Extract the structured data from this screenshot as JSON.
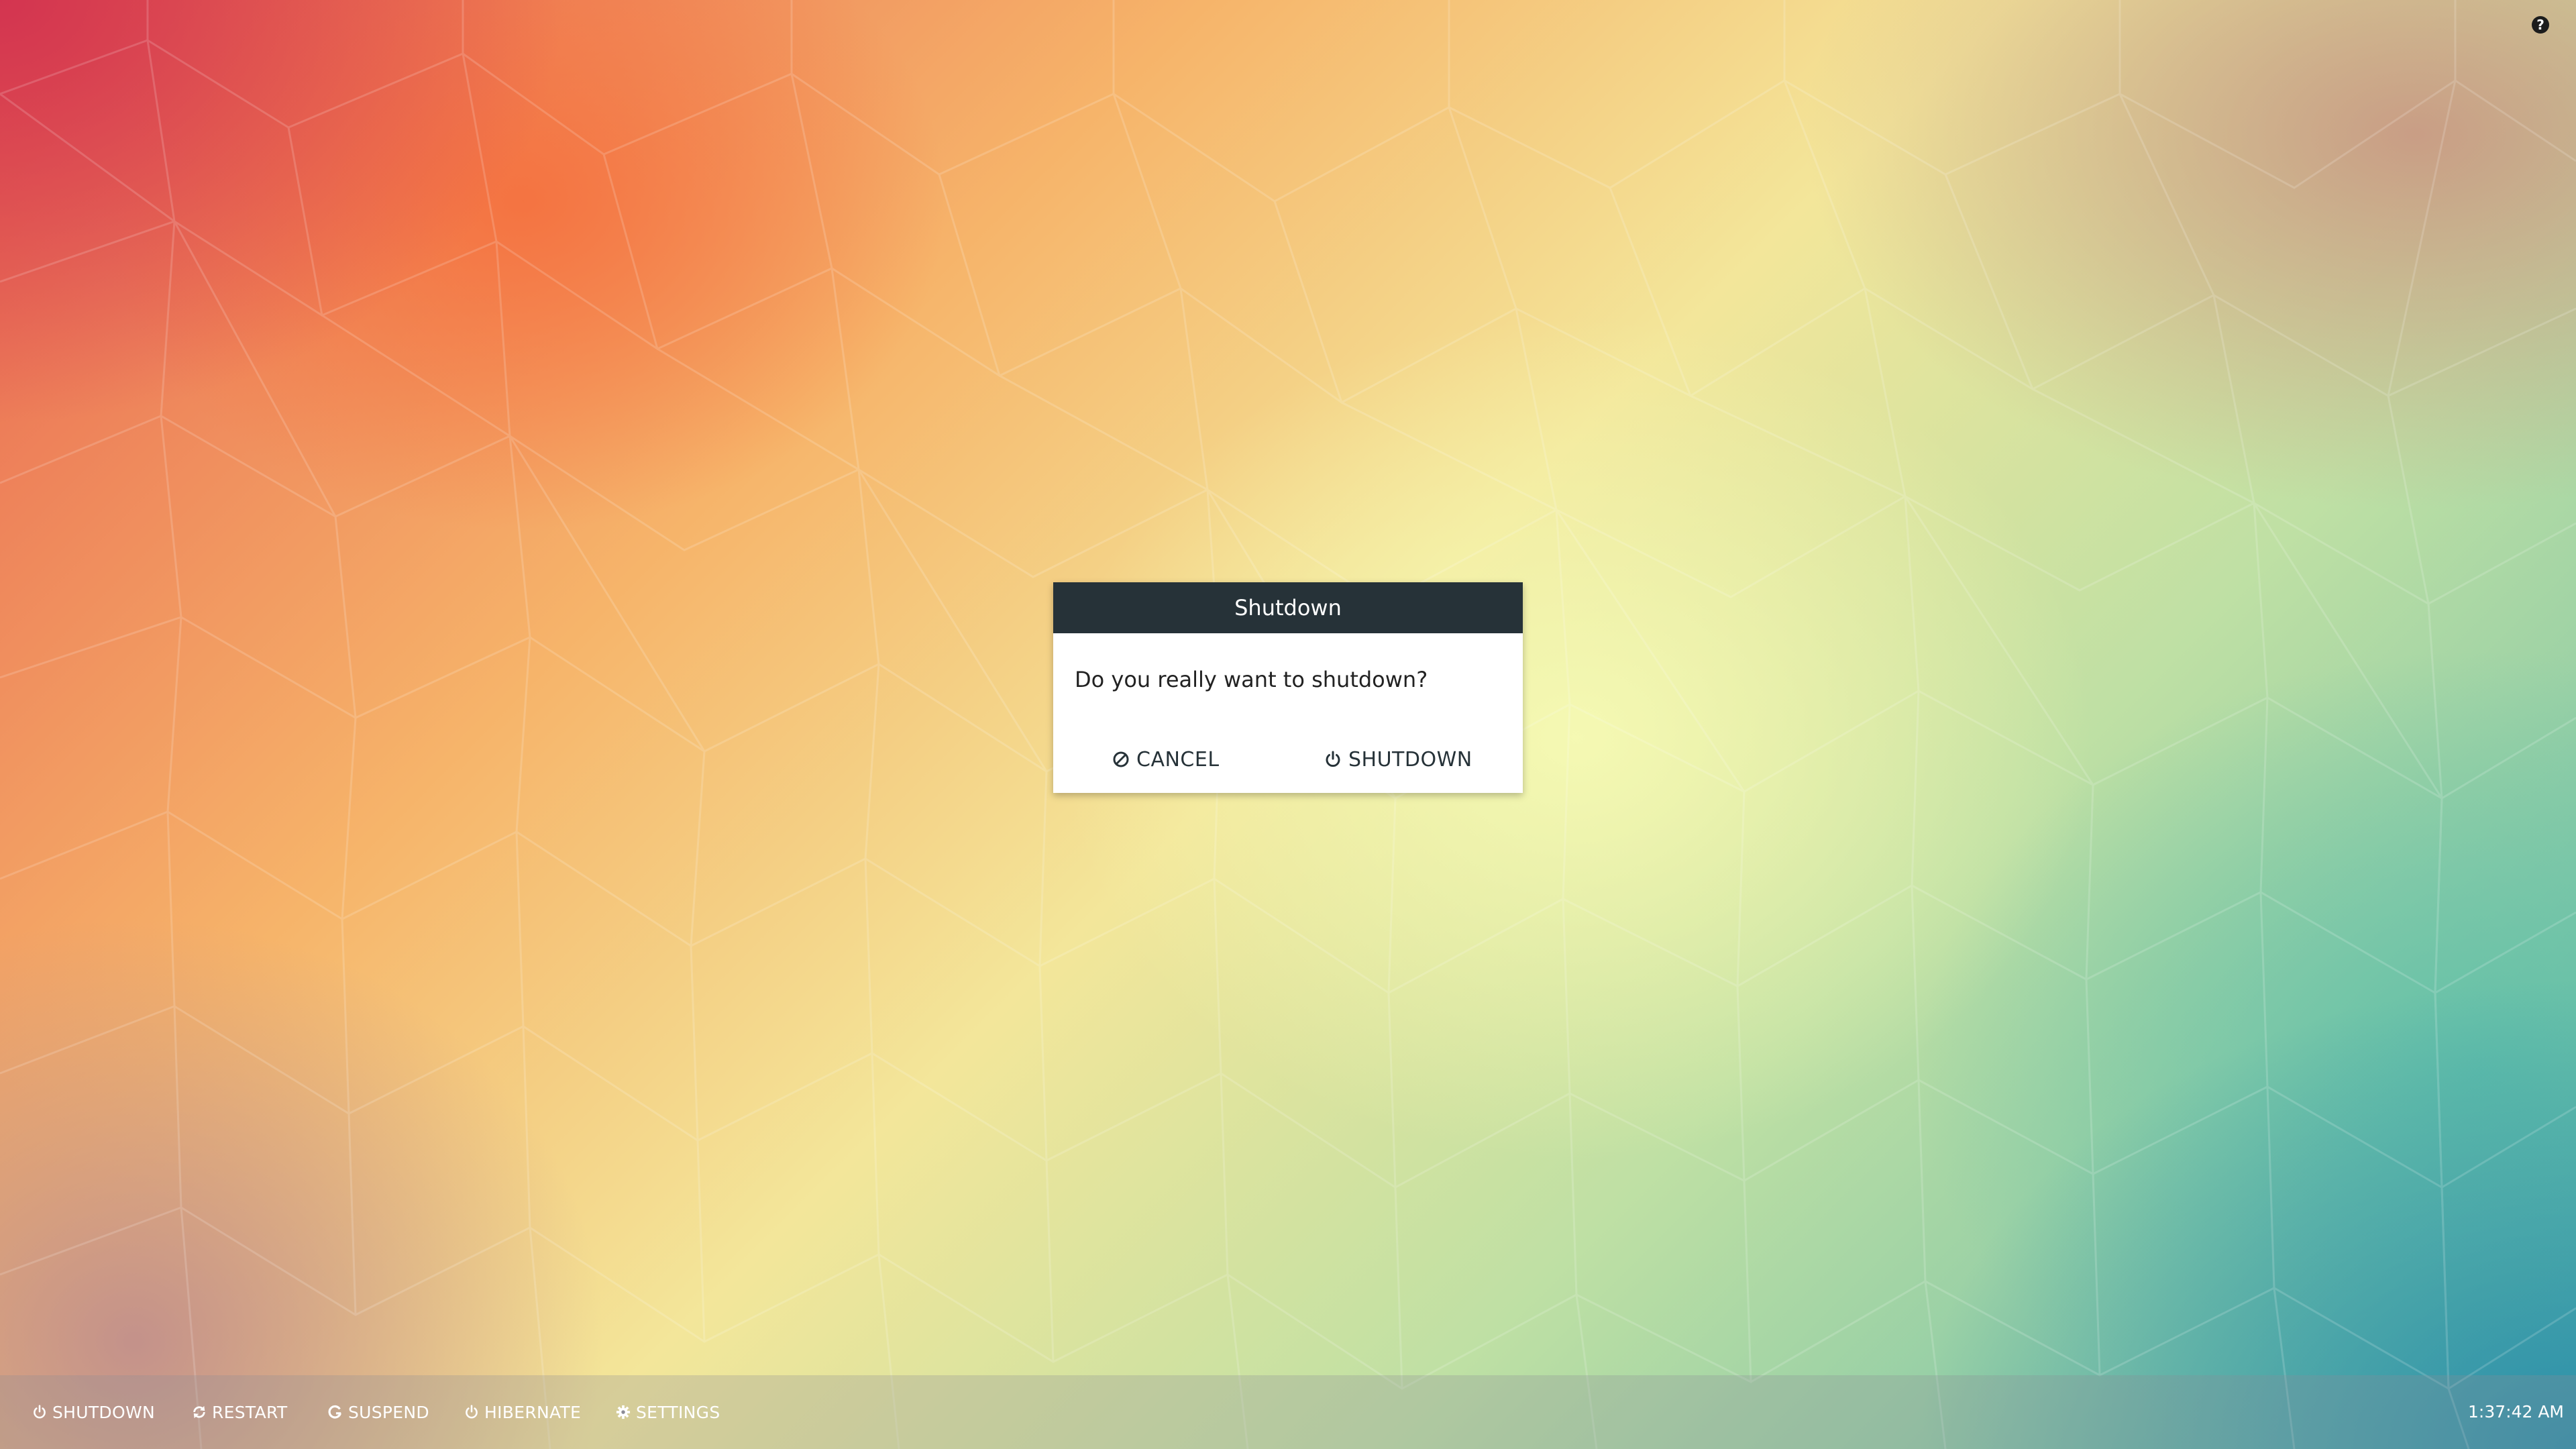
{
  "dialog": {
    "title": "Shutdown",
    "message": "Do you really want to shutdown?",
    "cancel_label": "CANCEL",
    "confirm_label": "SHUTDOWN"
  },
  "taskbar": {
    "items": [
      {
        "label": "SHUTDOWN",
        "icon": "power-icon"
      },
      {
        "label": "RESTART",
        "icon": "refresh-icon"
      },
      {
        "label": "SUSPEND",
        "icon": "suspend-icon"
      },
      {
        "label": "HIBERNATE",
        "icon": "power-icon"
      },
      {
        "label": "SETTINGS",
        "icon": "gear-icon"
      }
    ],
    "clock": "1:37:42 AM"
  },
  "help": {
    "icon": "help-icon",
    "glyph": "?"
  },
  "colors": {
    "dialog_header": "#263238",
    "dialog_text": "#263238",
    "taskbar_text": "#ffffff"
  }
}
